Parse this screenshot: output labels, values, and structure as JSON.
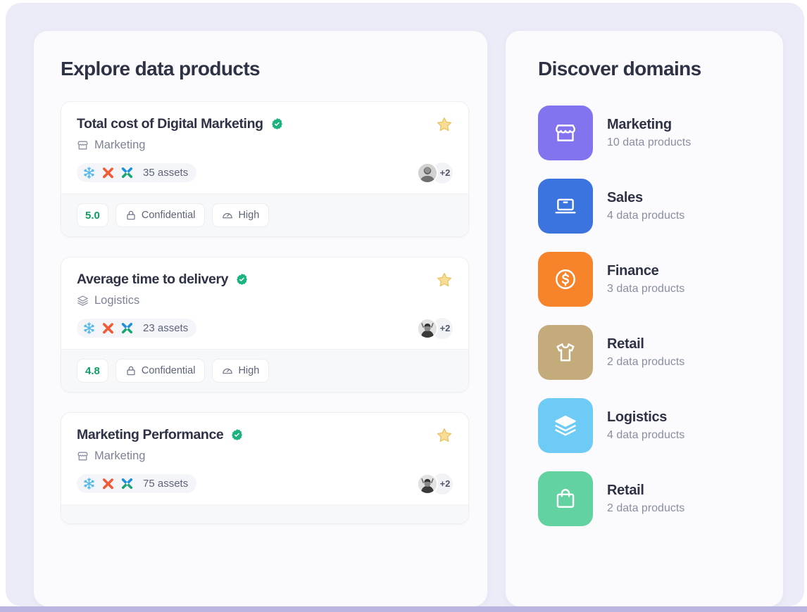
{
  "theme": {
    "shell_bg": "#ececf8",
    "panel_bg": "#fbfbfd",
    "card_bg": "#ffffff",
    "footer_bg": "#f7f8fa",
    "title_color": "#2e3245",
    "muted_color": "#7d8396",
    "rating_color": "#0f9d63",
    "verified_color": "#19b37b",
    "star_color": "#f5d57a",
    "bottom_bar_color": "#b9b6e0"
  },
  "explore": {
    "title": "Explore data products",
    "cards": [
      {
        "title": "Total cost of Digital Marketing",
        "verified": true,
        "starred": true,
        "domain": "Marketing",
        "domain_icon": "storefront-icon",
        "stack_icons": [
          "snowflake-icon",
          "dbt-icon",
          "airflow-icon"
        ],
        "assets": "35 assets",
        "avatar": "person-avatar",
        "avatar_more": "+2",
        "rating": "5.0",
        "classification": "Confidential",
        "classification_icon": "lock-icon",
        "criticality": "High",
        "criticality_icon": "gauge-icon"
      },
      {
        "title": "Average time to delivery",
        "verified": true,
        "starred": true,
        "domain": "Logistics",
        "domain_icon": "layers-icon",
        "stack_icons": [
          "snowflake-icon",
          "dbt-icon",
          "airflow-icon"
        ],
        "assets": "23 assets",
        "avatar": "person-avatar",
        "avatar_more": "+2",
        "rating": "4.8",
        "classification": "Confidential",
        "classification_icon": "lock-icon",
        "criticality": "High",
        "criticality_icon": "gauge-icon"
      },
      {
        "title": "Marketing Performance",
        "verified": true,
        "starred": true,
        "domain": "Marketing",
        "domain_icon": "storefront-icon",
        "stack_icons": [
          "snowflake-icon",
          "dbt-icon",
          "airflow-icon"
        ],
        "assets": "75 assets",
        "avatar": "person-avatar",
        "avatar_more": "+2",
        "rating": "",
        "classification": "",
        "classification_icon": "lock-icon",
        "criticality": "",
        "criticality_icon": "gauge-icon"
      }
    ]
  },
  "discover": {
    "title": "Discover domains",
    "domains": [
      {
        "name": "Marketing",
        "count": "10 data products",
        "icon": "storefront-icon",
        "color": "#8274ef"
      },
      {
        "name": "Sales",
        "count": "4 data products",
        "icon": "laptop-icon",
        "color": "#3b74de"
      },
      {
        "name": "Finance",
        "count": "3 data products",
        "icon": "dollar-coin-icon",
        "color": "#f7842b"
      },
      {
        "name": "Retail",
        "count": "2 data products",
        "icon": "tshirt-icon",
        "color": "#c4ab7b"
      },
      {
        "name": "Logistics",
        "count": "4 data products",
        "icon": "layers-icon",
        "color": "#6ecbf5"
      },
      {
        "name": "Retail",
        "count": "2 data products",
        "icon": "shopping-bag-icon",
        "color": "#62d3a0"
      }
    ]
  }
}
